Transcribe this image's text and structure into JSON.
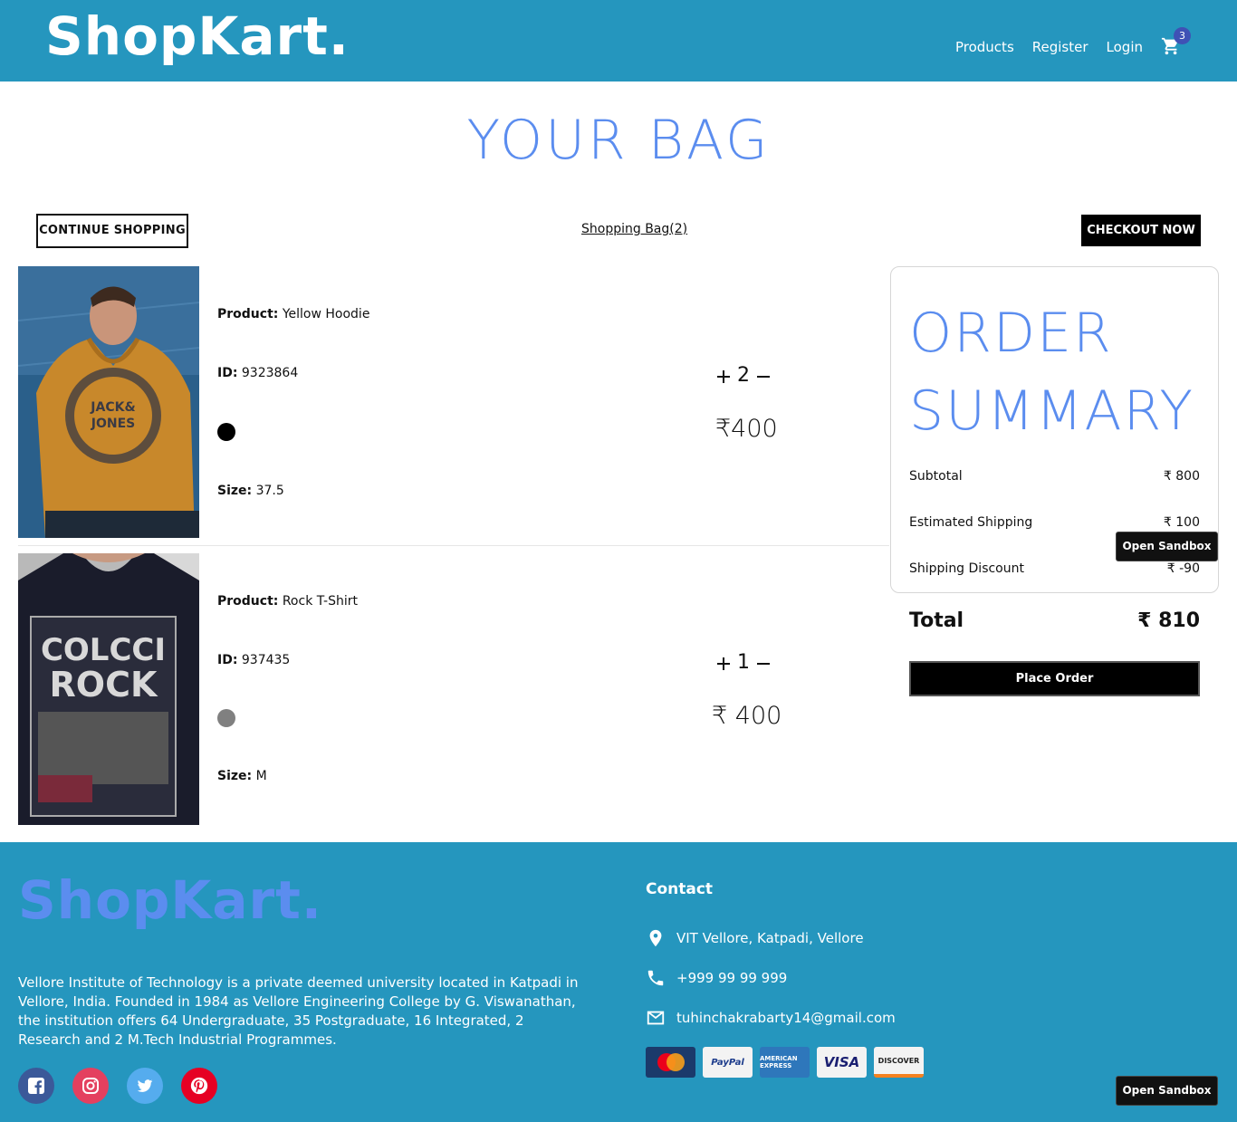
{
  "navbar": {
    "brand": "ShopKart.",
    "links": [
      "Products",
      "Register",
      "Login"
    ],
    "cart_count": "3"
  },
  "page_title": "YOUR BAG",
  "actions": {
    "continue_label": "CONTINUE SHOPPING",
    "bag_link": "Shopping Bag(2)",
    "checkout_label": "CHECKOUT NOW"
  },
  "products": [
    {
      "product_label": "Product:",
      "product_name": "Yellow Hoodie",
      "id_label": "ID:",
      "id_value": "9323864",
      "color": "#000000",
      "size_label": "Size:",
      "size_value": "37.5",
      "quantity": "2",
      "price": "₹400"
    },
    {
      "product_label": "Product:",
      "product_name": "Rock T-Shirt",
      "id_label": "ID:",
      "id_value": "937435",
      "color": "#808080",
      "size_label": "Size:",
      "size_value": "M",
      "quantity": "1",
      "price": "₹ 400"
    }
  ],
  "summary": {
    "title_line1": "ORDER",
    "title_line2": "SUMMARY",
    "subtotal_label": "Subtotal",
    "subtotal_value": "₹ 800",
    "shipping_label": "Estimated Shipping",
    "shipping_value": "₹ 100",
    "discount_label": "Shipping Discount",
    "discount_value": "₹ -90",
    "total_label": "Total",
    "total_value": "₹ 810",
    "place_order_label": "Place Order"
  },
  "sandbox_label": "Open Sandbox",
  "footer": {
    "brand": "ShopKart.",
    "description": "Vellore Institute of Technology is a private deemed university located in Katpadi in Vellore, India. Founded in 1984 as Vellore Engineering College by G. Viswanathan, the institution offers 64 Undergraduate, 35 Postgraduate, 16 Integrated, 2 Research and 2 M.Tech Industrial Programmes.",
    "contact_title": "Contact",
    "address": "VIT Vellore, Katpadi, Vellore",
    "phone": "+999 99 99 999",
    "email": "tuhinchakrabarty14@gmail.com",
    "payment_cards": [
      "MasterCard",
      "PayPal",
      "AMERICAN EXPRESS",
      "VISA",
      "DISCOVER"
    ],
    "social_colors": {
      "facebook": "#3b5999",
      "instagram": "#e4405f",
      "twitter": "#55acee",
      "pinterest": "#e60023"
    }
  },
  "colors": {
    "primary": "#2596be",
    "accent": "#5b8def"
  }
}
